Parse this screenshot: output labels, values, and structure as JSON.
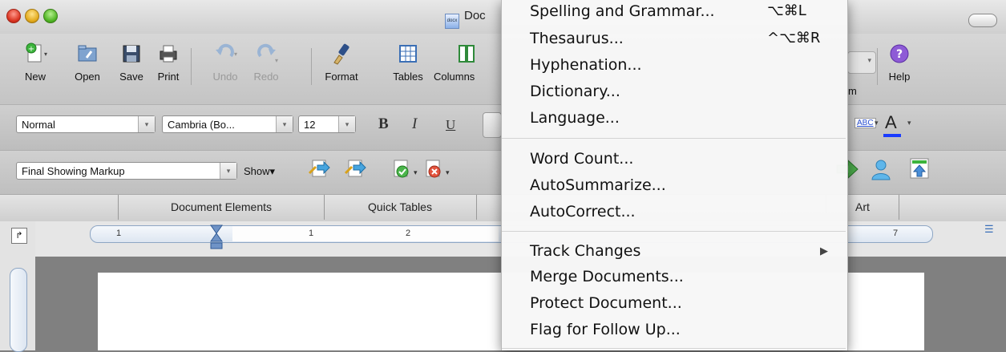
{
  "window": {
    "title": "Doc"
  },
  "toolbar": {
    "new": "New",
    "open": "Open",
    "save": "Save",
    "print": "Print",
    "undo": "Undo",
    "redo": "Redo",
    "format": "Format",
    "tables": "Tables",
    "columns": "Columns",
    "zoom": "m",
    "help": "Help"
  },
  "formatting": {
    "style": "Normal",
    "font": "Cambria (Bo...",
    "size": "12",
    "bold": "B",
    "italic": "I",
    "underline": "U",
    "highlight_label": "ABC",
    "font_color_label": "A"
  },
  "review": {
    "markup_mode": "Final Showing Markup",
    "show": "Show▾"
  },
  "gallery_tabs": [
    "Document Elements",
    "Quick Tables",
    "Art"
  ],
  "ruler": {
    "numbers": [
      "1",
      "1",
      "2",
      "7"
    ]
  },
  "menu": {
    "items": [
      {
        "label": "Spelling and Grammar...",
        "shortcut": "⌥⌘L"
      },
      {
        "label": "Thesaurus...",
        "shortcut": "^⌥⌘R"
      },
      {
        "label": "Hyphenation...",
        "shortcut": ""
      },
      {
        "label": "Dictionary...",
        "shortcut": ""
      },
      {
        "label": "Language...",
        "shortcut": ""
      },
      {
        "label": "Word Count...",
        "shortcut": ""
      },
      {
        "label": "AutoSummarize...",
        "shortcut": ""
      },
      {
        "label": "AutoCorrect...",
        "shortcut": ""
      },
      {
        "label": "Track Changes",
        "shortcut": "▶"
      },
      {
        "label": "Merge Documents...",
        "shortcut": ""
      },
      {
        "label": "Protect Document...",
        "shortcut": ""
      },
      {
        "label": "Flag for Follow Up...",
        "shortcut": ""
      }
    ]
  },
  "colors": {
    "font_color_underline": "#1a3cff",
    "highlight": "#ffffff"
  }
}
